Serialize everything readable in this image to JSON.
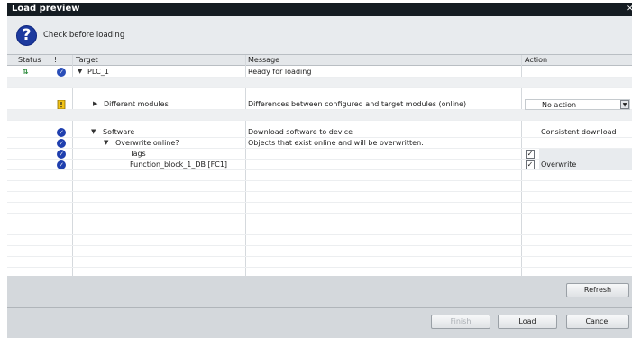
{
  "dialog": {
    "title": "Load preview",
    "info_message": "Check before loading"
  },
  "columns": [
    "Status",
    "!",
    "Target",
    "Message",
    "Action"
  ],
  "rows": [
    {
      "target": "PLC_1",
      "message": "Ready for loading",
      "action": ""
    },
    {
      "target": "Different modules",
      "message": "Differences between configured and target modules (online)",
      "action": "No action"
    },
    {
      "target": "Software",
      "message": "Download software to device",
      "action": "Consistent download"
    },
    {
      "target": "Overwrite online?",
      "message": "Objects that exist online and will be overwritten.",
      "action": ""
    },
    {
      "target": "Tags",
      "message": "",
      "action": ""
    },
    {
      "target": "Function_block_1_DB [FC1]",
      "message": "",
      "action": "Overwrite"
    }
  ],
  "checks": {
    "tags": true,
    "function_block": true
  },
  "buttons": {
    "refresh": "Refresh",
    "finish": "Finish",
    "load": "Load",
    "cancel": "Cancel"
  },
  "colors": {
    "titlebar": "#151c22",
    "ok_icon": "#1f3fae",
    "warning": "#f2c318"
  }
}
